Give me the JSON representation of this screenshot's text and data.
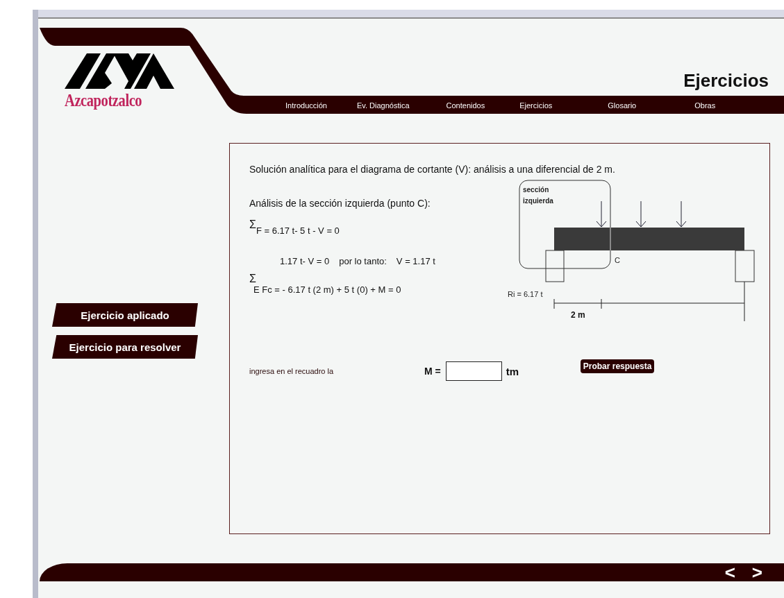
{
  "header": {
    "logo_text": "Azcapotzalco",
    "title": "Ejercicios",
    "nav": [
      {
        "label": "Introducción"
      },
      {
        "label": "Ev. Diagnóstica"
      },
      {
        "label": "Contenidos"
      },
      {
        "label": "Ejercicios"
      },
      {
        "label": "Glosario"
      },
      {
        "label": "Obras"
      }
    ]
  },
  "sidebar": {
    "buttons": [
      "Ejercicio aplicado",
      "Ejercicio para resolver"
    ]
  },
  "panel": {
    "heading": "Solución analítica para el diagrama de cortante  (V): análisis a una diferencial de 2 m.",
    "subheading": "Análisis de la sección izquierda (punto C):",
    "equations": [
      {
        "kind": "sum-inline",
        "sigma": "Σ",
        "text": "F = 6.17 t- 5 t - V = 0"
      },
      {
        "kind": "indented",
        "parts": [
          "1.17 t- V = 0",
          "por lo tanto:",
          "V = 1.17 t"
        ]
      },
      {
        "kind": "sum-above",
        "sigma": "Σ",
        "text": "E Fc = - 6.17 t (2 m) + 5 t (0) + M = 0"
      }
    ],
    "diagram": {
      "section_label": [
        "sección",
        "izquierda"
      ],
      "point_label": "C",
      "reaction_label": "Ri = 6.17 t",
      "distance_label": "2 m"
    },
    "answer": {
      "prompt": "ingresa en el recuadro la",
      "variable": "M =",
      "unit": "tm",
      "button": "Probar respuesta"
    }
  },
  "footer": {
    "prev": "<",
    "next": ">"
  }
}
